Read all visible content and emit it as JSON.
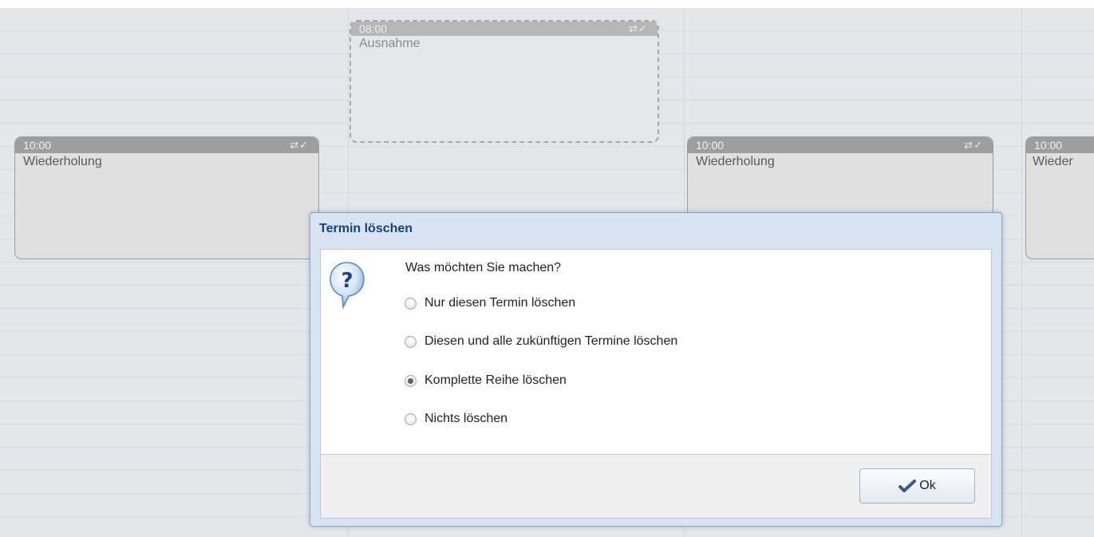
{
  "calendar": {
    "events": [
      {
        "time": "08:00",
        "title": "Ausnahme",
        "icons": "⇄✓",
        "kind": "exception"
      },
      {
        "time": "10:00",
        "title": "Wiederholung",
        "icons": "⇄✓",
        "kind": "recurring"
      },
      {
        "time": "10:00",
        "title": "Wiederholung",
        "icons": "⇄✓",
        "kind": "recurring"
      },
      {
        "time": "10:00",
        "title": "Wieder",
        "icons": "",
        "kind": "recurring"
      }
    ]
  },
  "dialog": {
    "title": "Termin löschen",
    "prompt": "Was möchten Sie machen?",
    "icon": "question-icon",
    "options": [
      {
        "label": "Nur diesen Termin löschen",
        "checked": false
      },
      {
        "label": "Diesen und alle zukünftigen Termine löschen",
        "checked": false
      },
      {
        "label": "Komplette Reihe löschen",
        "checked": true
      },
      {
        "label": "Nichts löschen",
        "checked": false
      }
    ],
    "ok_label": "Ok",
    "ok_icon": "checkmark-icon"
  },
  "colors": {
    "dialog_title": "#14408a",
    "event_header": "#9e9e9e"
  }
}
